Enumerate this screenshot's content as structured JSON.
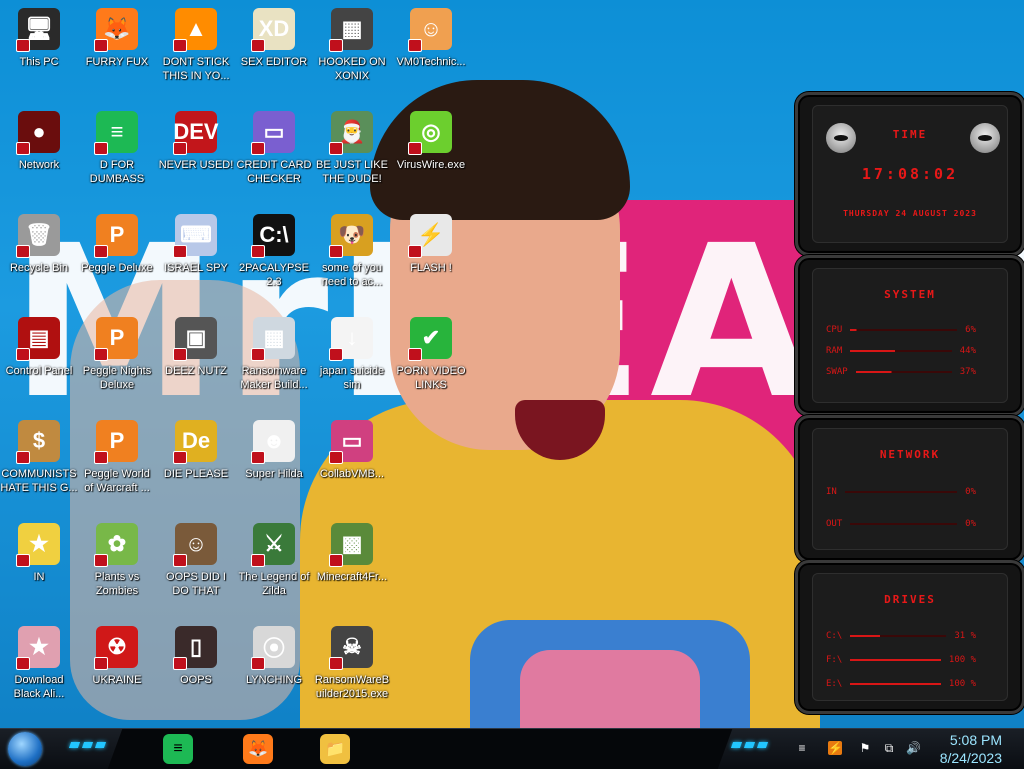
{
  "desktop": {
    "icons": [
      {
        "name": "this-pc",
        "label": "This PC",
        "col": 0,
        "row": 0,
        "color": "#2a2a2a",
        "glyph": "🖥"
      },
      {
        "name": "furry-fux",
        "label": "FURRY FUX",
        "col": 1,
        "row": 0,
        "color": "#ff7a1a",
        "glyph": "🦊"
      },
      {
        "name": "dont-stick",
        "label": "DONT STICK THIS IN YO...",
        "col": 2,
        "row": 0,
        "color": "#ff8c00",
        "glyph": "▲"
      },
      {
        "name": "sex-editor",
        "label": "SEX EDITOR",
        "col": 3,
        "row": 0,
        "color": "#e9e2c2",
        "glyph": "XD"
      },
      {
        "name": "hooked-on-xonix",
        "label": "HOOKED ON XONIX",
        "col": 4,
        "row": 0,
        "color": "#444444",
        "glyph": "▦"
      },
      {
        "name": "vm0technic",
        "label": "VM0Technic...",
        "col": 5,
        "row": 0,
        "color": "#f0a050",
        "glyph": "☺"
      },
      {
        "name": "network",
        "label": "Network",
        "col": 0,
        "row": 1,
        "color": "#6a0d0d",
        "glyph": "●"
      },
      {
        "name": "d-for-dumbass",
        "label": "D FOR DUMBASS",
        "col": 1,
        "row": 1,
        "color": "#1db954",
        "glyph": "≡"
      },
      {
        "name": "never-used",
        "label": "NEVER USED!",
        "col": 2,
        "row": 1,
        "color": "#c2161b",
        "glyph": "DEV"
      },
      {
        "name": "credit-card-checker",
        "label": "CREDIT CARD CHECKER",
        "col": 3,
        "row": 1,
        "color": "#7a5fd0",
        "glyph": "▭"
      },
      {
        "name": "be-just-like-the-dude",
        "label": "BE JUST LIKE THE DUDE!",
        "col": 4,
        "row": 1,
        "color": "#5a8f5a",
        "glyph": "🎅"
      },
      {
        "name": "viruswire",
        "label": "VirusWire.exe",
        "col": 5,
        "row": 1,
        "color": "#6ccf2e",
        "glyph": "◎"
      },
      {
        "name": "recycle-bin",
        "label": "Recycle Bin",
        "col": 0,
        "row": 2,
        "color": "#9a9a9a",
        "glyph": "🗑"
      },
      {
        "name": "peggle-deluxe",
        "label": "Peggle Deluxe",
        "col": 1,
        "row": 2,
        "color": "#f08020",
        "glyph": "P"
      },
      {
        "name": "israel-spy",
        "label": "ISRAEL SPY",
        "col": 2,
        "row": 2,
        "color": "#b8c8e8",
        "glyph": "⌨"
      },
      {
        "name": "2pacalypse",
        "label": "2PACALYPSE 2.3",
        "col": 3,
        "row": 2,
        "color": "#111111",
        "glyph": "C:\\"
      },
      {
        "name": "some-of-you",
        "label": "some of you need to ac...",
        "col": 4,
        "row": 2,
        "color": "#d8a020",
        "glyph": "🐶"
      },
      {
        "name": "flash",
        "label": "FLASH !",
        "col": 5,
        "row": 2,
        "color": "#e8e8e8",
        "glyph": "⚡"
      },
      {
        "name": "control-panel",
        "label": "Control Panel",
        "col": 0,
        "row": 3,
        "color": "#b01010",
        "glyph": "▤"
      },
      {
        "name": "peggle-nights-deluxe",
        "label": "Peggle Nights Deluxe",
        "col": 1,
        "row": 3,
        "color": "#f08020",
        "glyph": "P"
      },
      {
        "name": "deez-nutz",
        "label": "DEEZ NUTZ",
        "col": 2,
        "row": 3,
        "color": "#555555",
        "glyph": "▣"
      },
      {
        "name": "ransomware-maker",
        "label": "Ransomware Maker Build...",
        "col": 3,
        "row": 3,
        "color": "#cfd8e0",
        "glyph": "▦"
      },
      {
        "name": "japan-suicide-sim",
        "label": "japan suicide sim",
        "col": 4,
        "row": 3,
        "color": "#f4f4f4",
        "glyph": "↓"
      },
      {
        "name": "porn-video-links",
        "label": "PORN VIDEO LINKS",
        "col": 5,
        "row": 3,
        "color": "#28b43c",
        "glyph": "✔"
      },
      {
        "name": "communists",
        "label": "COMMUNISTS HATE THIS G...",
        "col": 0,
        "row": 4,
        "color": "#c08a40",
        "glyph": "$"
      },
      {
        "name": "peggle-world-of-warcraft",
        "label": "Peggle World of Warcraft ...",
        "col": 1,
        "row": 4,
        "color": "#f08020",
        "glyph": "P"
      },
      {
        "name": "die-please",
        "label": "DIE PLEASE",
        "col": 2,
        "row": 4,
        "color": "#e0b020",
        "glyph": "De"
      },
      {
        "name": "super-hilda",
        "label": "Super Hilda",
        "col": 3,
        "row": 4,
        "color": "#f0f0f0",
        "glyph": "☻"
      },
      {
        "name": "collabvm",
        "label": "CollabVMB...",
        "col": 4,
        "row": 4,
        "color": "#d04080",
        "glyph": "▭"
      },
      {
        "name": "star-butterfly",
        "label": "IN",
        "col": 0,
        "row": 5,
        "color": "#f0d040",
        "glyph": "★"
      },
      {
        "name": "plants-vs-zombies",
        "label": "Plants vs Zombies",
        "col": 1,
        "row": 5,
        "color": "#78b848",
        "glyph": "✿"
      },
      {
        "name": "oops-did-i-do-that",
        "label": "OOPS DID I DO THAT",
        "col": 2,
        "row": 5,
        "color": "#7a5a3a",
        "glyph": "☺"
      },
      {
        "name": "the-legend-of-zilda",
        "label": "The Legend of Zilda",
        "col": 3,
        "row": 5,
        "color": "#3a7a3a",
        "glyph": "⚔"
      },
      {
        "name": "minecraft4fr",
        "label": "Minecraft4Fr...",
        "col": 4,
        "row": 5,
        "color": "#5a8a3a",
        "glyph": "▩"
      },
      {
        "name": "download-black-ali",
        "label": "Download Black Ali...",
        "col": 0,
        "row": 6,
        "color": "#e0a0b0",
        "glyph": "★"
      },
      {
        "name": "ukraine",
        "label": "UKRAINE",
        "col": 1,
        "row": 6,
        "color": "#d01818",
        "glyph": "☢"
      },
      {
        "name": "oops",
        "label": "OOPS",
        "col": 2,
        "row": 6,
        "color": "#3a2a2a",
        "glyph": "▯"
      },
      {
        "name": "lynching",
        "label": "LYNCHING",
        "col": 3,
        "row": 6,
        "color": "#d8d8d8",
        "glyph": "⦿"
      },
      {
        "name": "ransomware-builder-2015",
        "label": "RansomWareBuilder2015.exe",
        "col": 4,
        "row": 6,
        "color": "#444444",
        "glyph": "☠"
      }
    ]
  },
  "widgets": {
    "time": {
      "title": "TIME",
      "clock": "17:08:02",
      "date": "THURSDAY 24 AUGUST 2023"
    },
    "system": {
      "title": "SYSTEM",
      "rows": [
        {
          "label": "CPU",
          "value": "6%",
          "fill": 0.06
        },
        {
          "label": "RAM",
          "value": "44%",
          "fill": 0.44
        },
        {
          "label": "SWAP",
          "value": "37%",
          "fill": 0.37
        }
      ]
    },
    "network": {
      "title": "NETWORK",
      "rows": [
        {
          "label": "IN",
          "value": "0%"
        },
        {
          "label": "OUT",
          "value": "0%"
        }
      ]
    },
    "drives": {
      "title": "DRIVES",
      "rows": [
        {
          "label": "C:\\",
          "value": "31 %",
          "fill": 0.31
        },
        {
          "label": "F:\\",
          "value": "100 %",
          "fill": 1.0
        },
        {
          "label": "E:\\",
          "value": "100 %",
          "fill": 1.0
        }
      ]
    }
  },
  "taskbar": {
    "apps": [
      {
        "name": "notepad-green-app",
        "glyph": "≡",
        "color": "#1db954"
      },
      {
        "name": "firefox-app",
        "glyph": "🦊",
        "color": "#ff7a1a"
      },
      {
        "name": "file-explorer-app",
        "glyph": "📁",
        "color": "#f0c040"
      }
    ],
    "time": "5:08 PM",
    "date": "8/24/2023"
  }
}
